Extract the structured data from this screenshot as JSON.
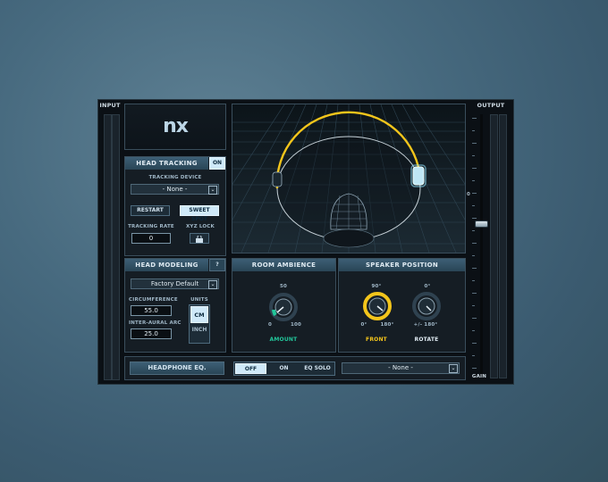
{
  "meters": {
    "input_label": "INPUT",
    "output_label": "OUTPUT",
    "gain_label": "GAIN",
    "zero_label": "0"
  },
  "logo": {
    "text": "nx"
  },
  "head_tracking": {
    "title": "HEAD TRACKING",
    "toggle": "ON",
    "device_label": "TRACKING DEVICE",
    "device_value": "- None -",
    "restart": "RESTART",
    "sweet_spot": "SWEET SPOT",
    "rate_label": "TRACKING RATE",
    "rate_value": "0",
    "xyz_label": "XYZ LOCK"
  },
  "head_modeling": {
    "title": "HEAD MODELING",
    "help": "?",
    "preset": "Factory Default",
    "circumference_label": "CIRCUMFERENCE",
    "circumference_value": "55.0",
    "interaural_label": "INTER-AURAL ARC",
    "interaural_value": "25.0",
    "units_label": "UNITS",
    "unit_cm": "CM",
    "unit_inch": "INCH"
  },
  "room_ambience": {
    "title": "ROOM AMBIENCE",
    "top": "50",
    "min": "0",
    "max": "100",
    "label": "AMOUNT",
    "amount": 0.15
  },
  "speaker_position": {
    "title": "SPEAKER POSITION",
    "front_top": "90°",
    "front_min": "0°",
    "front_max": "180°",
    "front_label": "FRONT",
    "rotate_top": "0°",
    "rotate_range": "+/- 180°",
    "rotate_label": "ROTATE"
  },
  "headphone_eq": {
    "label": "HEADPHONE EQ.",
    "opt_off": "OFF",
    "opt_on": "ON",
    "opt_solo": "EQ SOLO",
    "preset": "- None -"
  },
  "colors": {
    "accent": "#f3c51b",
    "teal": "#22c79b",
    "panel": "#151d24"
  }
}
